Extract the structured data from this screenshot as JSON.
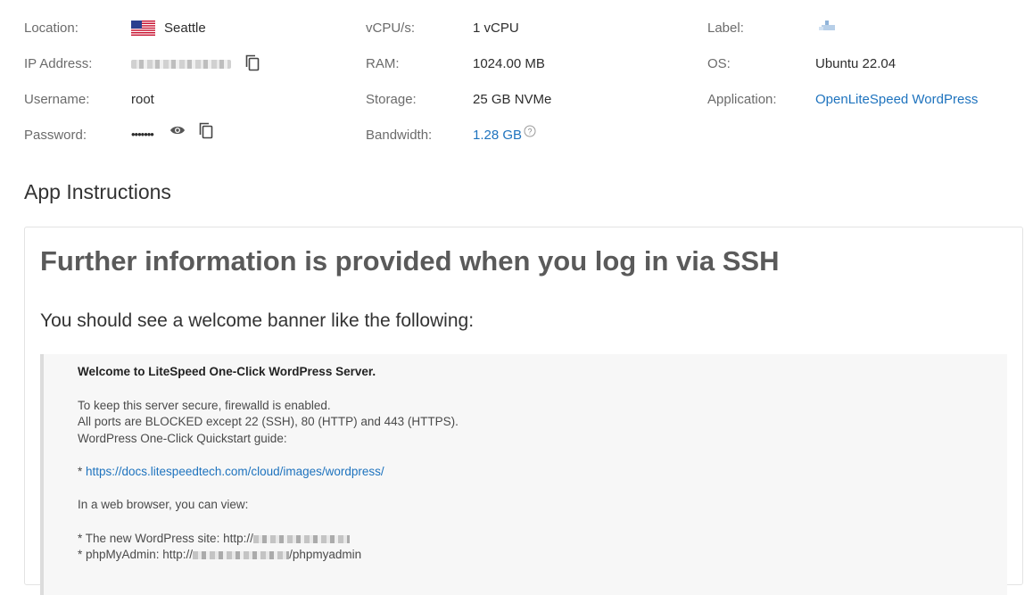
{
  "details": {
    "location_label": "Location:",
    "location_value": "Seattle",
    "ip_label": "IP Address:",
    "username_label": "Username:",
    "username_value": "root",
    "password_label": "Password:",
    "password_value": "•••••••",
    "vcpu_label": "vCPU/s:",
    "vcpu_value": "1 vCPU",
    "ram_label": "RAM:",
    "ram_value": "1024.00 MB",
    "storage_label": "Storage:",
    "storage_value": "25 GB NVMe",
    "bandwidth_label": "Bandwidth:",
    "bandwidth_value": "1.28 GB",
    "label_label": "Label:",
    "os_label": "OS:",
    "os_value": "Ubuntu 22.04",
    "application_label": "Application:",
    "application_value": "OpenLiteSpeed WordPress"
  },
  "icons": {
    "flag": "us-flag-icon",
    "copy": "copy-icon",
    "eye": "eye-icon",
    "help": "help-icon",
    "label": "tag-icon"
  },
  "instructions": {
    "section_title": "App Instructions",
    "heading": "Further information is provided when you log in via SSH",
    "subheading": "You should see a welcome banner like the following:",
    "banner": {
      "line1": "Welcome to LiteSpeed One-Click WordPress Server.",
      "line2": "To keep this server secure, firewalld is enabled.",
      "line3": "All ports are BLOCKED except 22 (SSH), 80 (HTTP) and 443 (HTTPS).",
      "line4": "WordPress One-Click Quickstart guide:",
      "line5_prefix": "* ",
      "line5_link": "https://docs.litespeedtech.com/cloud/images/wordpress/",
      "line6": "In a web browser, you can view:",
      "line7": "* The new WordPress site: http://",
      "line8_prefix": "* phpMyAdmin: http://",
      "line8_suffix": "/phpmyadmin"
    }
  },
  "colors": {
    "link": "#1e73be",
    "label": "#6b6b6b"
  }
}
